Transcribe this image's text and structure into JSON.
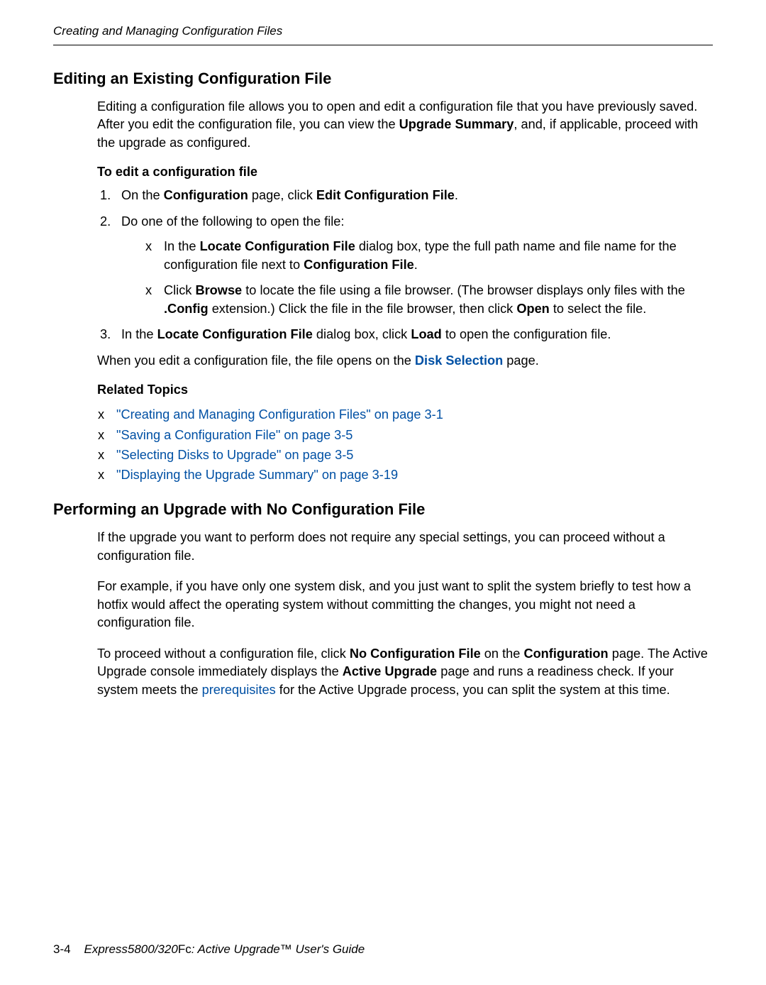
{
  "header": {
    "running": "Creating and Managing Configuration Files"
  },
  "sec1": {
    "title": "Editing an Existing Configuration File",
    "intro_1": "Editing a configuration file allows you to open and edit a configuration file that you have previously saved. After you edit the configuration file, you can view the ",
    "intro_bold": "Upgrade Summary",
    "intro_2": ", and, if applicable, proceed with the upgrade as configured.",
    "proc_title": "To edit a configuration file",
    "step1_a": "On the ",
    "step1_b": "Configuration",
    "step1_c": " page, click ",
    "step1_d": "Edit Configuration File",
    "step1_e": ".",
    "step2": "Do one of the following to open the file:",
    "step2_b1_a": "In the ",
    "step2_b1_b": "Locate Configuration File",
    "step2_b1_c": " dialog box, type the full path name and file name for the configuration file next to ",
    "step2_b1_d": "Configuration File",
    "step2_b1_e": ".",
    "step2_b2_a": "Click ",
    "step2_b2_b": "Browse",
    "step2_b2_c": " to locate the file using a file browser. (The browser displays only files with the ",
    "step2_b2_d": ".Config",
    "step2_b2_e": " extension.) Click the file in the file browser, then click ",
    "step2_b2_f": "Open",
    "step2_b2_g": " to select the file.",
    "step3_a": "In the ",
    "step3_b": "Locate Configuration File",
    "step3_c": " dialog box, click ",
    "step3_d": "Load",
    "step3_e": " to open the configuration file.",
    "after_a": "When you edit a configuration file, the file opens on the ",
    "after_link": "Disk Selection",
    "after_b": " page.",
    "related_title": "Related Topics",
    "rel1": "\"Creating and Managing Configuration Files\" on page 3-1",
    "rel2": "\"Saving a Configuration File\" on page 3-5",
    "rel3": "\"Selecting Disks to Upgrade\" on page 3-5",
    "rel4": "\"Displaying the Upgrade Summary\" on page 3-19"
  },
  "sec2": {
    "title": "Performing an Upgrade with No Configuration File",
    "p1": "If the upgrade you want to perform does not require any special settings, you can proceed without a configuration file.",
    "p2": "For example, if you have only one system disk, and you just want to split the system briefly to test how a hotfix would affect the operating system without committing the changes, you might not need a configuration file.",
    "p3_a": "To proceed without a configuration file, click ",
    "p3_b": "No Configuration File",
    "p3_c": " on the ",
    "p3_d": "Configuration",
    "p3_e": " page. The Active Upgrade console immediately displays the ",
    "p3_f": "Active Upgrade",
    "p3_g": " page and runs a readiness check. If your system meets the ",
    "p3_link": "prerequisites",
    "p3_h": " for the Active Upgrade process, you can split the system at this time."
  },
  "footer": {
    "page": "3-4",
    "title_a": "Express5800/320",
    "title_fc": "Fc",
    "title_b": ": Active Upgrade™ User's Guide"
  }
}
